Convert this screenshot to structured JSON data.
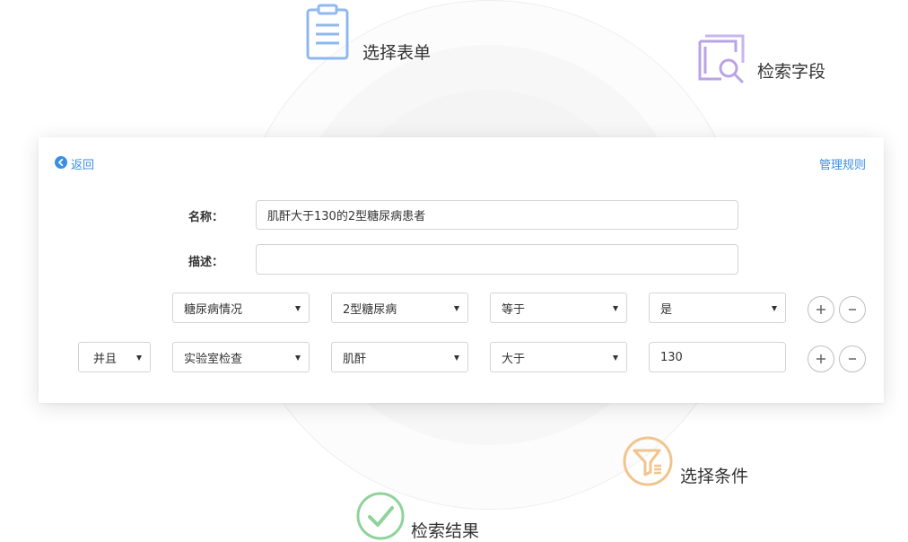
{
  "features": {
    "select_form": {
      "label": "选择表单",
      "icon": "clipboard-list-icon",
      "color": "#8fb8ef"
    },
    "search_field": {
      "label": "检索字段",
      "icon": "document-search-icon",
      "color": "#b9a3e6"
    },
    "select_condition": {
      "label": "选择条件",
      "icon": "filter-icon",
      "color": "#f1c48c"
    },
    "search_result": {
      "label": "检索结果",
      "icon": "check-circle-icon",
      "color": "#8fd39a"
    }
  },
  "header": {
    "back_label": "返回",
    "manage_label": "管理规则"
  },
  "form": {
    "name_label": "名称：",
    "name_value": "肌酐大于130的2型糖尿病患者",
    "desc_label": "描述：",
    "desc_value": ""
  },
  "rules": [
    {
      "connector": "",
      "category": "糖尿病情况",
      "item": "2型糖尿病",
      "operator": "等于",
      "value": "是"
    },
    {
      "connector": "并且",
      "category": "实验室检查",
      "item": "肌酐",
      "operator": "大于",
      "value": "130"
    }
  ],
  "colors": {
    "link": "#3a8ee6",
    "text": "#333333",
    "border": "#d4d4d4"
  }
}
